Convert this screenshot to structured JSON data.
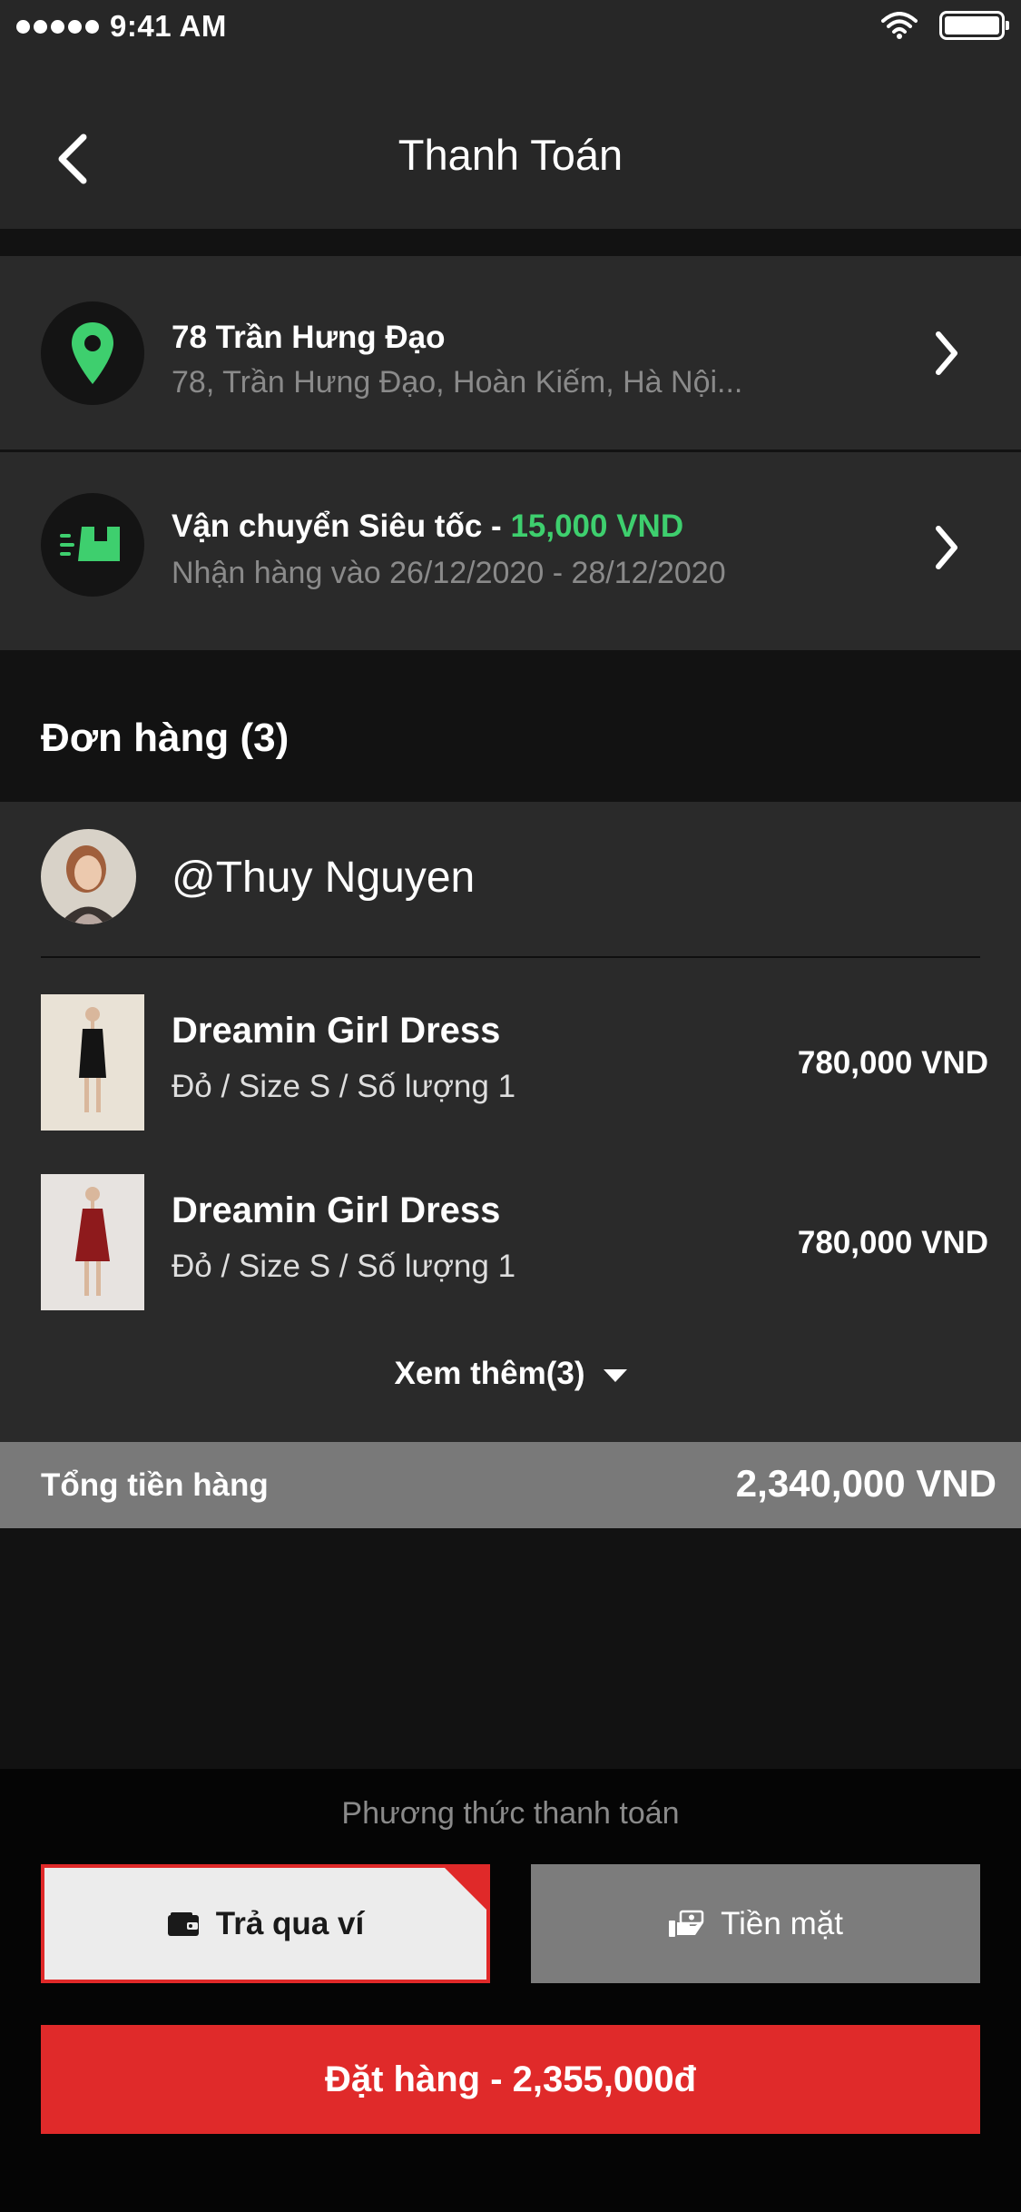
{
  "status_bar": {
    "time": "9:41 AM",
    "battery_level": 1.0
  },
  "header": {
    "title": "Thanh Toán"
  },
  "address": {
    "title": "78 Trần Hưng Đạo",
    "detail": "78, Trần Hưng Đạo, Hoàn Kiếm, Hà Nội..."
  },
  "shipping": {
    "title_prefix": "Vận chuyển Siêu tốc -",
    "fee": "15,000 VND",
    "delivery": "Nhận hàng vào 26/12/2020 - 28/12/2020"
  },
  "order": {
    "heading": "Đơn hàng (3)",
    "seller": "@Thuy Nguyen",
    "products": [
      {
        "name": "Dreamin Girl Dress",
        "meta": "Đỏ / Size S / Số lượng 1",
        "price": "780,000 VND"
      },
      {
        "name": "Dreamin Girl Dress",
        "meta": "Đỏ / Size S / Số lượng 1",
        "price": "780,000 VND"
      }
    ],
    "see_more": "Xem thêm(3)"
  },
  "total": {
    "label": "Tổng tiền hàng",
    "value": "2,340,000 VND"
  },
  "payment": {
    "label": "Phương thức thanh toán",
    "wallet_label": "Trả qua ví",
    "cash_label": "Tiền mặt",
    "selected": "wallet"
  },
  "checkout": {
    "label": "Đặt hàng - 2,355,000đ"
  },
  "colors": {
    "accent_red": "#e02a2a",
    "accent_green": "#3ecf6e",
    "card_bg": "#2a2a2a",
    "page_bg": "#121212"
  },
  "icons": {
    "address": "location-pin-icon",
    "shipping": "fast-delivery-icon",
    "wallet": "wallet-icon",
    "cash": "cash-hand-icon"
  }
}
